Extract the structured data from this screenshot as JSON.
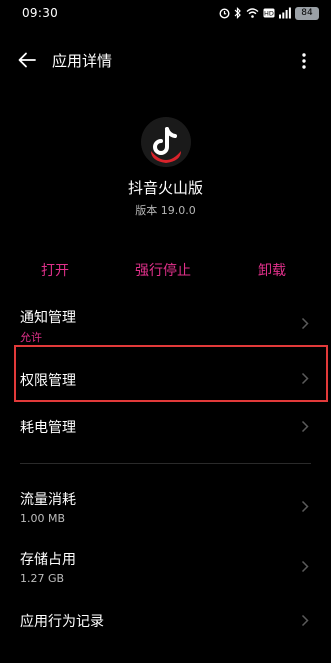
{
  "status_bar": {
    "time": "09:30",
    "battery": "84"
  },
  "header": {
    "title": "应用详情"
  },
  "app": {
    "name": "抖音火山版",
    "version": "版本 19.0.0"
  },
  "actions": {
    "open": "打开",
    "force_stop": "强行停止",
    "uninstall": "卸载"
  },
  "settings": {
    "notification": {
      "title": "通知管理",
      "value": "允许"
    },
    "permission": {
      "title": "权限管理"
    },
    "power": {
      "title": "耗电管理"
    },
    "data_usage": {
      "title": "流量消耗",
      "value": "1.00 MB"
    },
    "storage": {
      "title": "存储占用",
      "value": "1.27 GB"
    },
    "app_behavior": {
      "title": "应用行为记录"
    }
  },
  "colors": {
    "accent": "#e0308a",
    "highlight": "#e23a3a",
    "background": "#000000"
  },
  "icons": [
    "back-arrow-icon",
    "more-vertical-icon",
    "tiktok-app-icon",
    "chevron-right-icon",
    "wifi-icon",
    "signal-icon",
    "alarm-icon",
    "battery-icon"
  ]
}
